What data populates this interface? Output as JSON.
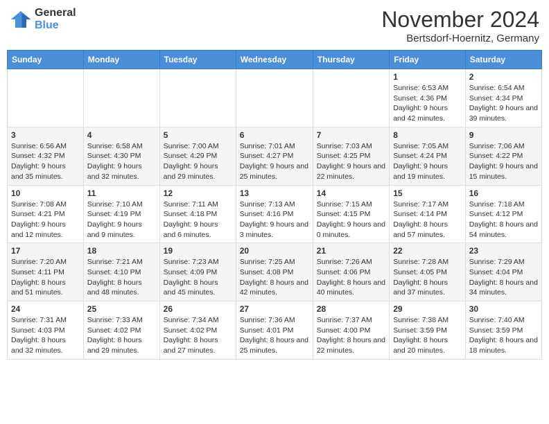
{
  "logo": {
    "general": "General",
    "blue": "Blue"
  },
  "title": "November 2024",
  "location": "Bertsdorf-Hoernitz, Germany",
  "weekdays": [
    "Sunday",
    "Monday",
    "Tuesday",
    "Wednesday",
    "Thursday",
    "Friday",
    "Saturday"
  ],
  "weeks": [
    [
      {
        "day": "",
        "info": ""
      },
      {
        "day": "",
        "info": ""
      },
      {
        "day": "",
        "info": ""
      },
      {
        "day": "",
        "info": ""
      },
      {
        "day": "",
        "info": ""
      },
      {
        "day": "1",
        "info": "Sunrise: 6:53 AM\nSunset: 4:36 PM\nDaylight: 9 hours and 42 minutes."
      },
      {
        "day": "2",
        "info": "Sunrise: 6:54 AM\nSunset: 4:34 PM\nDaylight: 9 hours and 39 minutes."
      }
    ],
    [
      {
        "day": "3",
        "info": "Sunrise: 6:56 AM\nSunset: 4:32 PM\nDaylight: 9 hours and 35 minutes."
      },
      {
        "day": "4",
        "info": "Sunrise: 6:58 AM\nSunset: 4:30 PM\nDaylight: 9 hours and 32 minutes."
      },
      {
        "day": "5",
        "info": "Sunrise: 7:00 AM\nSunset: 4:29 PM\nDaylight: 9 hours and 29 minutes."
      },
      {
        "day": "6",
        "info": "Sunrise: 7:01 AM\nSunset: 4:27 PM\nDaylight: 9 hours and 25 minutes."
      },
      {
        "day": "7",
        "info": "Sunrise: 7:03 AM\nSunset: 4:25 PM\nDaylight: 9 hours and 22 minutes."
      },
      {
        "day": "8",
        "info": "Sunrise: 7:05 AM\nSunset: 4:24 PM\nDaylight: 9 hours and 19 minutes."
      },
      {
        "day": "9",
        "info": "Sunrise: 7:06 AM\nSunset: 4:22 PM\nDaylight: 9 hours and 15 minutes."
      }
    ],
    [
      {
        "day": "10",
        "info": "Sunrise: 7:08 AM\nSunset: 4:21 PM\nDaylight: 9 hours and 12 minutes."
      },
      {
        "day": "11",
        "info": "Sunrise: 7:10 AM\nSunset: 4:19 PM\nDaylight: 9 hours and 9 minutes."
      },
      {
        "day": "12",
        "info": "Sunrise: 7:11 AM\nSunset: 4:18 PM\nDaylight: 9 hours and 6 minutes."
      },
      {
        "day": "13",
        "info": "Sunrise: 7:13 AM\nSunset: 4:16 PM\nDaylight: 9 hours and 3 minutes."
      },
      {
        "day": "14",
        "info": "Sunrise: 7:15 AM\nSunset: 4:15 PM\nDaylight: 9 hours and 0 minutes."
      },
      {
        "day": "15",
        "info": "Sunrise: 7:17 AM\nSunset: 4:14 PM\nDaylight: 8 hours and 57 minutes."
      },
      {
        "day": "16",
        "info": "Sunrise: 7:18 AM\nSunset: 4:12 PM\nDaylight: 8 hours and 54 minutes."
      }
    ],
    [
      {
        "day": "17",
        "info": "Sunrise: 7:20 AM\nSunset: 4:11 PM\nDaylight: 8 hours and 51 minutes."
      },
      {
        "day": "18",
        "info": "Sunrise: 7:21 AM\nSunset: 4:10 PM\nDaylight: 8 hours and 48 minutes."
      },
      {
        "day": "19",
        "info": "Sunrise: 7:23 AM\nSunset: 4:09 PM\nDaylight: 8 hours and 45 minutes."
      },
      {
        "day": "20",
        "info": "Sunrise: 7:25 AM\nSunset: 4:08 PM\nDaylight: 8 hours and 42 minutes."
      },
      {
        "day": "21",
        "info": "Sunrise: 7:26 AM\nSunset: 4:06 PM\nDaylight: 8 hours and 40 minutes."
      },
      {
        "day": "22",
        "info": "Sunrise: 7:28 AM\nSunset: 4:05 PM\nDaylight: 8 hours and 37 minutes."
      },
      {
        "day": "23",
        "info": "Sunrise: 7:29 AM\nSunset: 4:04 PM\nDaylight: 8 hours and 34 minutes."
      }
    ],
    [
      {
        "day": "24",
        "info": "Sunrise: 7:31 AM\nSunset: 4:03 PM\nDaylight: 8 hours and 32 minutes."
      },
      {
        "day": "25",
        "info": "Sunrise: 7:33 AM\nSunset: 4:02 PM\nDaylight: 8 hours and 29 minutes."
      },
      {
        "day": "26",
        "info": "Sunrise: 7:34 AM\nSunset: 4:02 PM\nDaylight: 8 hours and 27 minutes."
      },
      {
        "day": "27",
        "info": "Sunrise: 7:36 AM\nSunset: 4:01 PM\nDaylight: 8 hours and 25 minutes."
      },
      {
        "day": "28",
        "info": "Sunrise: 7:37 AM\nSunset: 4:00 PM\nDaylight: 8 hours and 22 minutes."
      },
      {
        "day": "29",
        "info": "Sunrise: 7:38 AM\nSunset: 3:59 PM\nDaylight: 8 hours and 20 minutes."
      },
      {
        "day": "30",
        "info": "Sunrise: 7:40 AM\nSunset: 3:59 PM\nDaylight: 8 hours and 18 minutes."
      }
    ]
  ]
}
